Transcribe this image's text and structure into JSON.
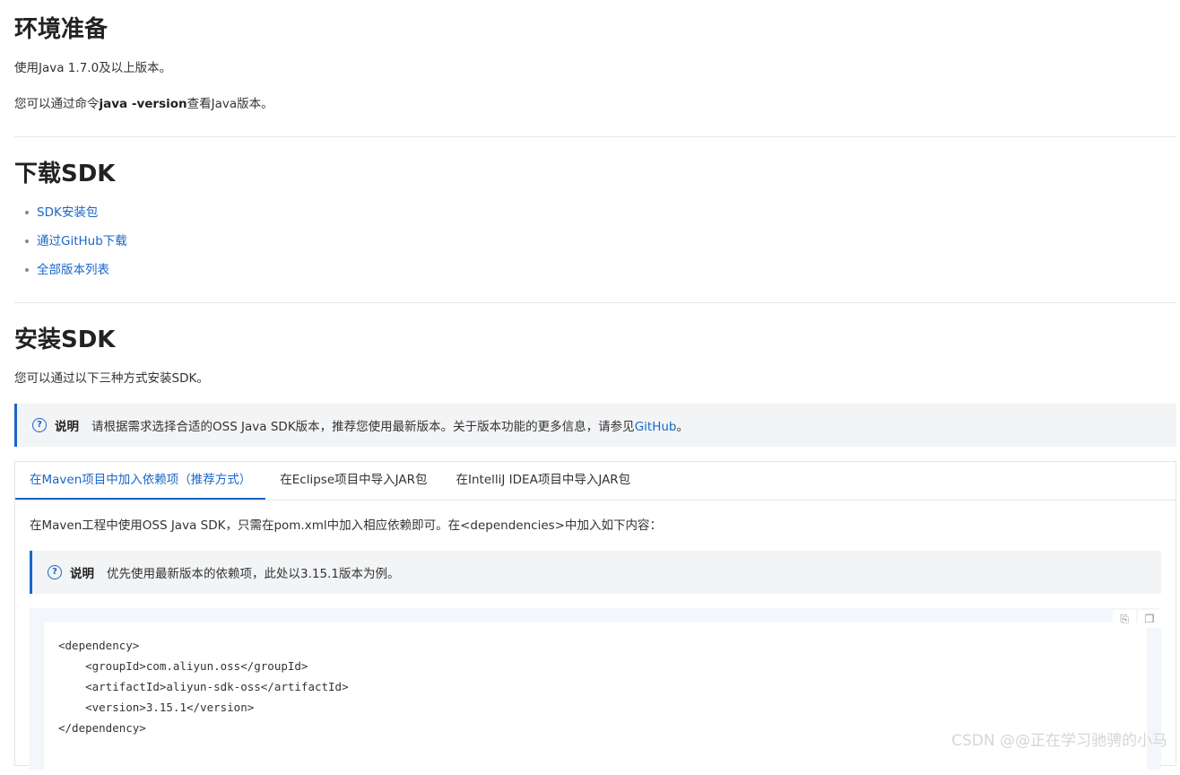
{
  "sections": {
    "env": {
      "title": "环境准备",
      "line1": "使用Java 1.7.0及以上版本。",
      "line2_pre": "您可以通过命令",
      "line2_cmd": "java -version",
      "line2_post": "查看Java版本。"
    },
    "download": {
      "title": "下载SDK",
      "links": [
        "SDK安装包",
        "通过GitHub下载",
        "全部版本列表"
      ]
    },
    "install": {
      "title": "安装SDK",
      "intro": "您可以通过以下三种方式安装SDK。",
      "note_label": "说明",
      "note_text": "请根据需求选择合适的OSS Java SDK版本，推荐您使用最新版本。关于版本功能的更多信息，请参见",
      "note_link": "GitHub",
      "note_end": "。",
      "tabs": [
        "在Maven项目中加入依赖项（推荐方式）",
        "在Eclipse项目中导入JAR包",
        "在IntelliJ IDEA项目中导入JAR包"
      ],
      "maven_text": "在Maven工程中使用OSS Java SDK，只需在pom.xml中加入相应依赖即可。在<dependencies>中加入如下内容：",
      "inner_note_label": "说明",
      "inner_note_text": "优先使用最新版本的依赖项，此处以3.15.1版本为例。",
      "code": "<dependency>\n    <groupId>com.aliyun.oss</groupId>\n    <artifactId>aliyun-sdk-oss</artifactId>\n    <version>3.15.1</version>\n</dependency>"
    }
  },
  "icons": {
    "note": "question-circle-icon",
    "copy_a": "copy-file-icon",
    "copy_b": "copy-icon"
  },
  "colors": {
    "link": "#1a66c9",
    "note_bg": "#f3f4f6"
  },
  "watermark": "CSDN @@正在学习驰骋的小马"
}
